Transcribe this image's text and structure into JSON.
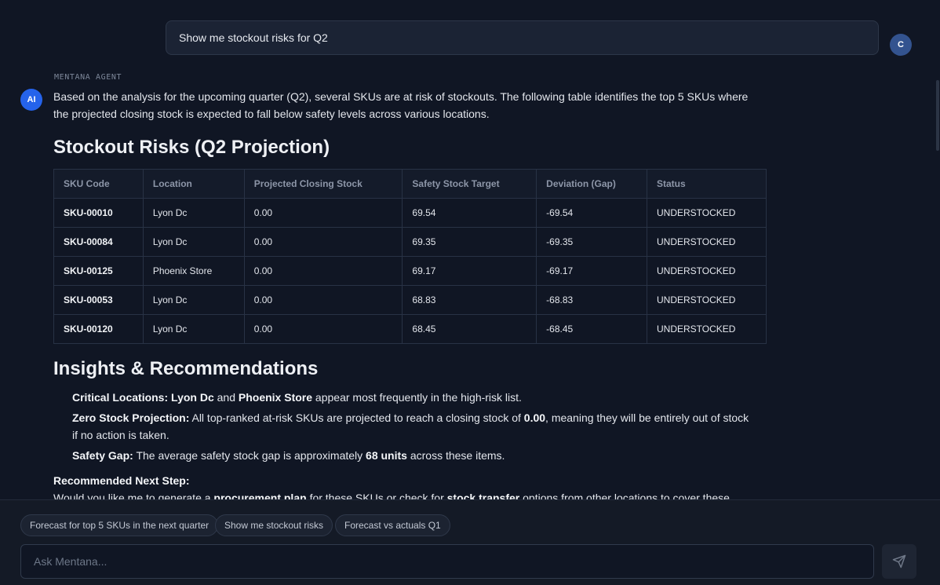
{
  "user_message": {
    "text": "Show me stockout risks for Q2",
    "avatar": "C"
  },
  "agent": {
    "label": "MENTANA AGENT",
    "avatar": "AI",
    "intro": "Based on the analysis for the upcoming quarter (Q2), several SKUs are at risk of stockouts. The following table identifies the top 5 SKUs where the projected closing stock is expected to fall below safety levels across various locations.",
    "risks_heading": "Stockout Risks (Q2 Projection)",
    "table": {
      "headers": [
        "SKU Code",
        "Location",
        "Projected Closing Stock",
        "Safety Stock Target",
        "Deviation (Gap)",
        "Status"
      ],
      "rows": [
        [
          "SKU-00010",
          "Lyon Dc",
          "0.00",
          "69.54",
          "-69.54",
          "UNDERSTOCKED"
        ],
        [
          "SKU-00084",
          "Lyon Dc",
          "0.00",
          "69.35",
          "-69.35",
          "UNDERSTOCKED"
        ],
        [
          "SKU-00125",
          "Phoenix Store",
          "0.00",
          "69.17",
          "-69.17",
          "UNDERSTOCKED"
        ],
        [
          "SKU-00053",
          "Lyon Dc",
          "0.00",
          "68.83",
          "-68.83",
          "UNDERSTOCKED"
        ],
        [
          "SKU-00120",
          "Lyon Dc",
          "0.00",
          "68.45",
          "-68.45",
          "UNDERSTOCKED"
        ]
      ]
    },
    "insights_heading": "Insights & Recommendations",
    "insights": [
      {
        "title": "Critical Locations:",
        "loc1": "Lyon Dc",
        "and": "and",
        "loc2": "Phoenix Store",
        "rest": "appear most frequently in the high-risk list."
      },
      {
        "title": "Zero Stock Projection:",
        "text1": "All top-ranked at-risk SKUs are projected to reach a closing stock of",
        "value": "0.00",
        "text2": ", meaning they will be entirely out of stock if no action is taken."
      },
      {
        "title": "Safety Gap:",
        "text1": "The average safety stock gap is approximately",
        "value": "68 units",
        "text2": "across these items."
      }
    ],
    "next_step_label": "Recommended Next Step:",
    "next_step": {
      "text1": "Would you like me to generate a",
      "bold1": "procurement plan",
      "text2": "for these SKUs or check for",
      "bold2": "stock transfer",
      "text3": "options from other locations to cover these gaps?"
    }
  },
  "suggestions": [
    "Forecast for top 5 SKUs in the next quarter",
    "Show me stockout risks",
    "Forecast vs actuals Q1"
  ],
  "input": {
    "placeholder": "Ask Mentana..."
  },
  "send_icon": "send-icon"
}
